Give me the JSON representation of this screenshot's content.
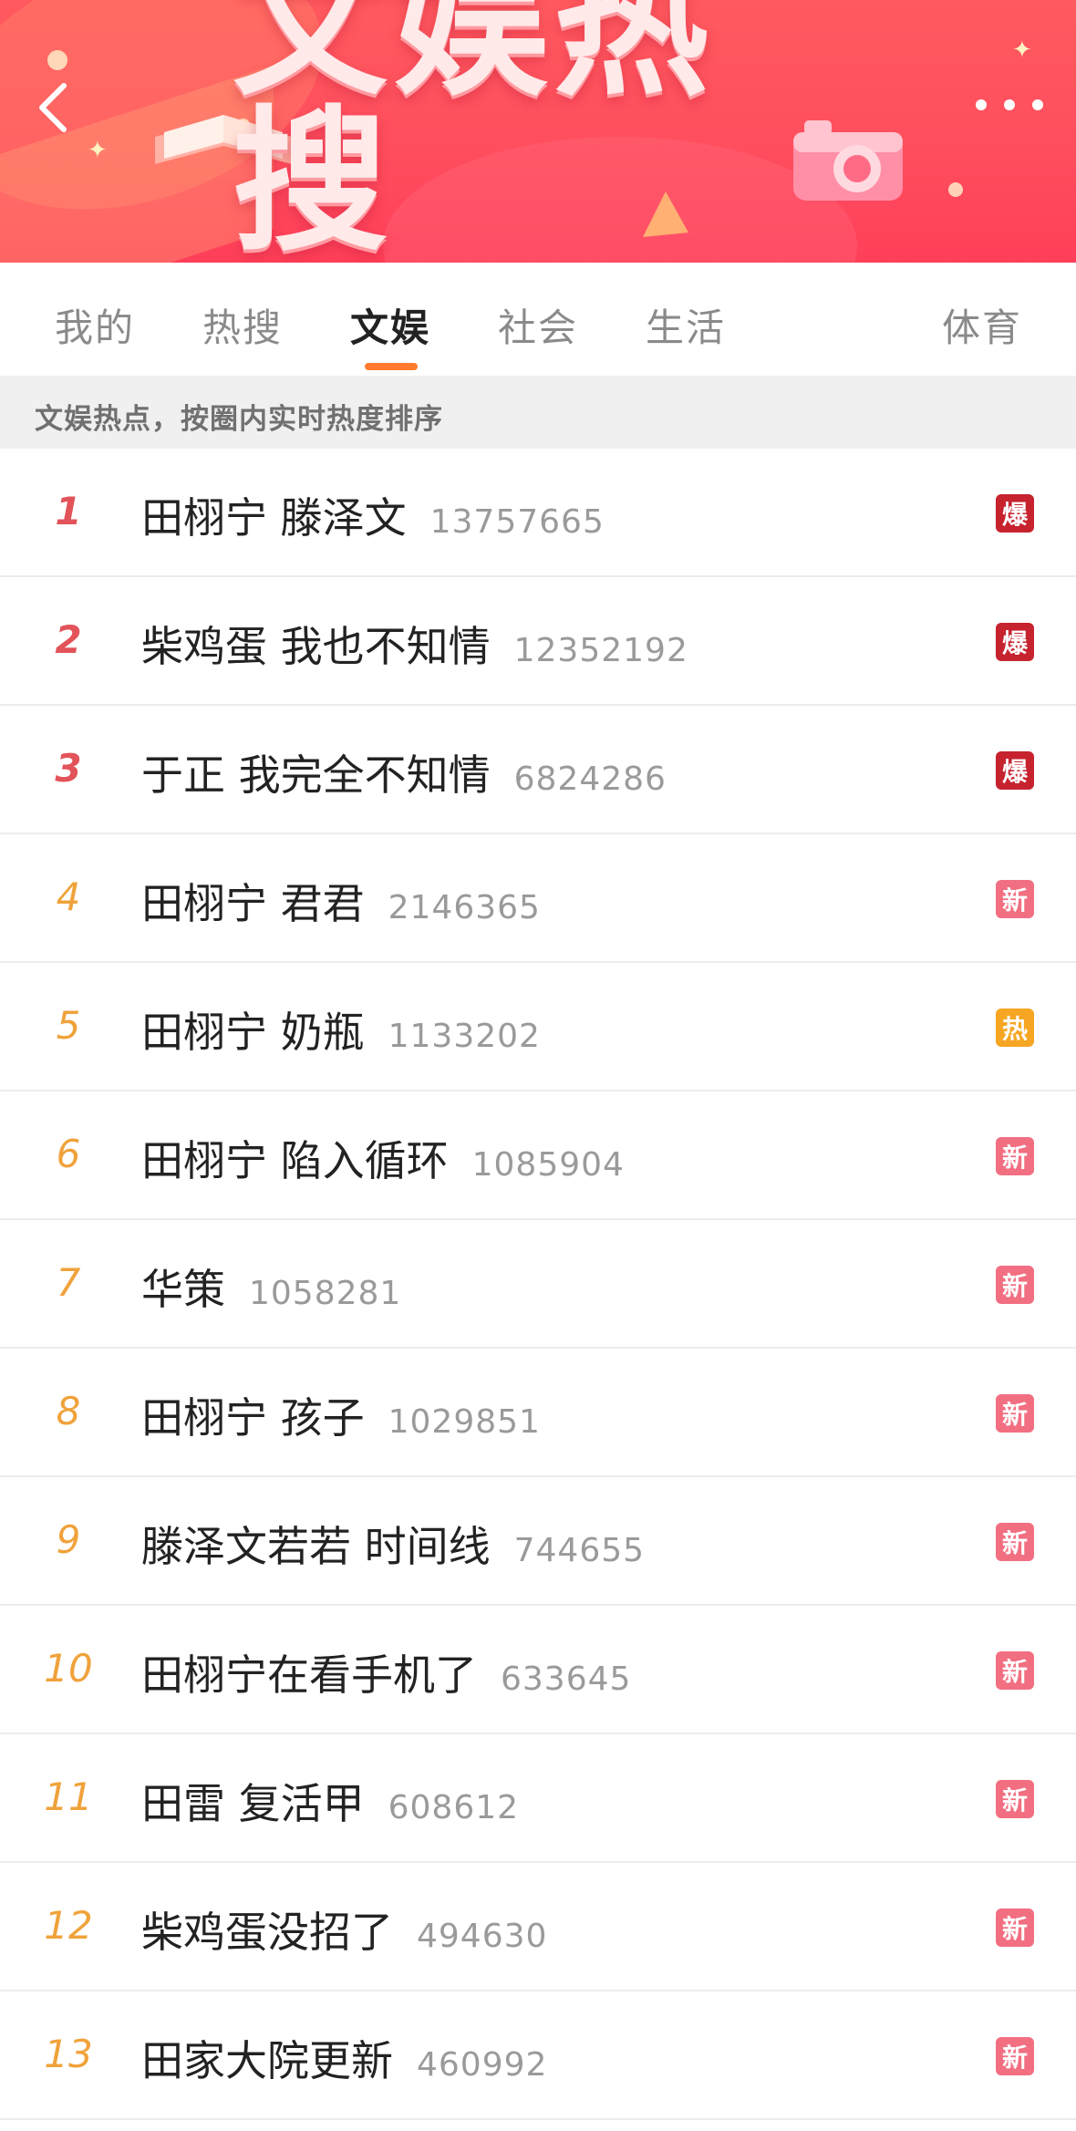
{
  "header": {
    "title": "文娱热搜",
    "back_icon": "chevron-left-icon",
    "more_icon": "more-horizontal-icon"
  },
  "tabs": [
    {
      "label": "我的",
      "active": false
    },
    {
      "label": "热搜",
      "active": false
    },
    {
      "label": "文娱",
      "active": true
    },
    {
      "label": "社会",
      "active": false
    },
    {
      "label": "生活",
      "active": false
    },
    {
      "label": "体育",
      "active": false
    }
  ],
  "subheader": "文娱热点，按圈内实时热度排序",
  "colors": {
    "accent": "#ff7a2e",
    "rank_top": "#e2535a",
    "rank_other": "#f0a23a",
    "badge_bao": "#c6232f",
    "badge_xin": "#f26f82",
    "badge_re": "#f6a623"
  },
  "items": [
    {
      "rank": "1",
      "topic": "田栩宁 滕泽文",
      "count": "13757665",
      "badge": "爆",
      "badge_type": "bao"
    },
    {
      "rank": "2",
      "topic": "柴鸡蛋 我也不知情",
      "count": "12352192",
      "badge": "爆",
      "badge_type": "bao"
    },
    {
      "rank": "3",
      "topic": "于正 我完全不知情",
      "count": "6824286",
      "badge": "爆",
      "badge_type": "bao"
    },
    {
      "rank": "4",
      "topic": "田栩宁 君君",
      "count": "2146365",
      "badge": "新",
      "badge_type": "xin"
    },
    {
      "rank": "5",
      "topic": "田栩宁 奶瓶",
      "count": "1133202",
      "badge": "热",
      "badge_type": "re"
    },
    {
      "rank": "6",
      "topic": "田栩宁 陷入循环",
      "count": "1085904",
      "badge": "新",
      "badge_type": "xin"
    },
    {
      "rank": "7",
      "topic": "华策",
      "count": "1058281",
      "badge": "新",
      "badge_type": "xin"
    },
    {
      "rank": "8",
      "topic": "田栩宁 孩子",
      "count": "1029851",
      "badge": "新",
      "badge_type": "xin"
    },
    {
      "rank": "9",
      "topic": "滕泽文若若 时间线",
      "count": "744655",
      "badge": "新",
      "badge_type": "xin"
    },
    {
      "rank": "10",
      "topic": "田栩宁在看手机了",
      "count": "633645",
      "badge": "新",
      "badge_type": "xin"
    },
    {
      "rank": "11",
      "topic": "田雷 复活甲",
      "count": "608612",
      "badge": "新",
      "badge_type": "xin"
    },
    {
      "rank": "12",
      "topic": "柴鸡蛋没招了",
      "count": "494630",
      "badge": "新",
      "badge_type": "xin"
    },
    {
      "rank": "13",
      "topic": "田家大院更新",
      "count": "460992",
      "badge": "新",
      "badge_type": "xin"
    }
  ]
}
